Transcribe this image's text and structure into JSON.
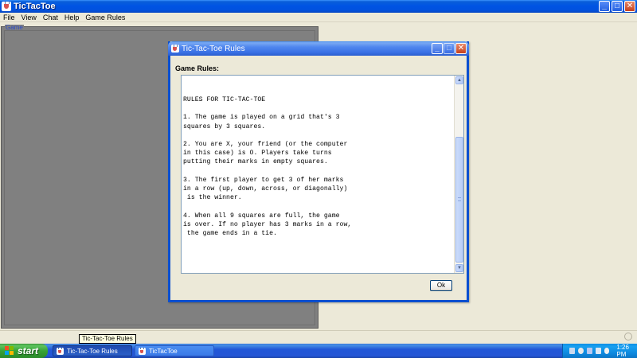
{
  "window": {
    "title": "TicTacToe",
    "minimize_glyph": "_",
    "maximize_glyph": "□",
    "close_glyph": "✕"
  },
  "menu": [
    "File",
    "View",
    "Chat",
    "Help",
    "Game Rules"
  ],
  "game_panel": {
    "label": "Game"
  },
  "dialog": {
    "title": "Tic-Tac-Toe Rules",
    "label": "Game Rules:",
    "text": "RULES FOR TIC-TAC-TOE\n\n1. The game is played on a grid that's 3\nsquares by 3 squares.\n\n2. You are X, your friend (or the computer\nin this case) is O. Players take turns\nputting their marks in empty squares.\n\n3. The first player to get 3 of her marks\nin a row (up, down, across, or diagonally)\n is the winner.\n\n4. When all 9 squares are full, the game\nis over. If no player has 3 marks in a row,\n the game ends in a tie.",
    "ok_label": "Ok",
    "scroll_up_glyph": "▲",
    "scroll_down_glyph": "▼"
  },
  "tooltip": "Tic-Tac-Toe Rules",
  "taskbar": {
    "start_label": "start",
    "buttons": [
      {
        "label": "Tic-Tac-Toe Rules",
        "active": true
      },
      {
        "label": "TicTacToe",
        "active": false
      }
    ],
    "clock": "1:26 PM"
  },
  "icons": {
    "app": "java-cup-icon",
    "start": "windows-flag-icon"
  },
  "colors": {
    "title_bar": "#0054e3",
    "dialog_title": "#3a72e6",
    "game_panel": "#808080",
    "desktop_bg": "#ece9d8",
    "taskbar": "#2456d6",
    "start_button": "#37a337",
    "tray": "#0d87dd"
  }
}
